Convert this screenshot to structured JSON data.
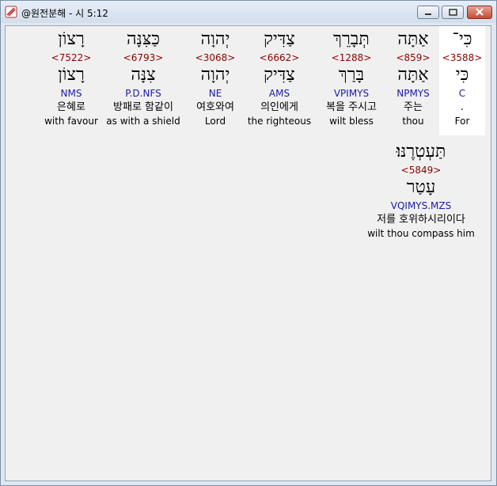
{
  "window": {
    "title": "@원전분해 - 시 5:12",
    "minimize_label": "",
    "maximize_label": "",
    "close_label": ""
  },
  "words": [
    {
      "heb": "כִּי־",
      "strong": "<3588>",
      "lemma": "כִּי",
      "morph": "C",
      "ko": ".",
      "en": "For"
    },
    {
      "heb": "אַתָּה",
      "strong": "<859>",
      "lemma": "אַתָּה",
      "morph": "NPMYS",
      "ko": "주는",
      "en": "thou"
    },
    {
      "heb": "תְּבָרֵךְ",
      "strong": "<1288>",
      "lemma": "בָּרַךְ",
      "morph": "VPIMYS",
      "ko": "복을 주시고",
      "en": "wilt bless"
    },
    {
      "heb": "צַדִּיק",
      "strong": "<6662>",
      "lemma": "צַדִּיק",
      "morph": "AMS",
      "ko": "의인에게",
      "en": "the righteous"
    },
    {
      "heb": "יְהוָה",
      "strong": "<3068>",
      "lemma": "יְהוָה",
      "morph": "NE",
      "ko": "여호와여",
      "en": "Lord"
    },
    {
      "heb": "כַּצִּנָּה",
      "strong": "<6793>",
      "lemma": "צִנָּה",
      "morph": "P.D.NFS",
      "ko": "방패로 함같이",
      "en": "as with a shield"
    },
    {
      "heb": "רָצוֹן",
      "strong": "<7522>",
      "lemma": "רָצוֹן",
      "morph": "NMS",
      "ko": "은혜로",
      "en": "with favour"
    },
    {
      "heb": "תַּעְטְרֶנּוּ׃",
      "strong": "<5849>",
      "lemma": "עָטַר",
      "morph": "VQIMYS.MZS",
      "ko": "저를 호위하시리이다",
      "en": "wilt thou compass him"
    }
  ]
}
